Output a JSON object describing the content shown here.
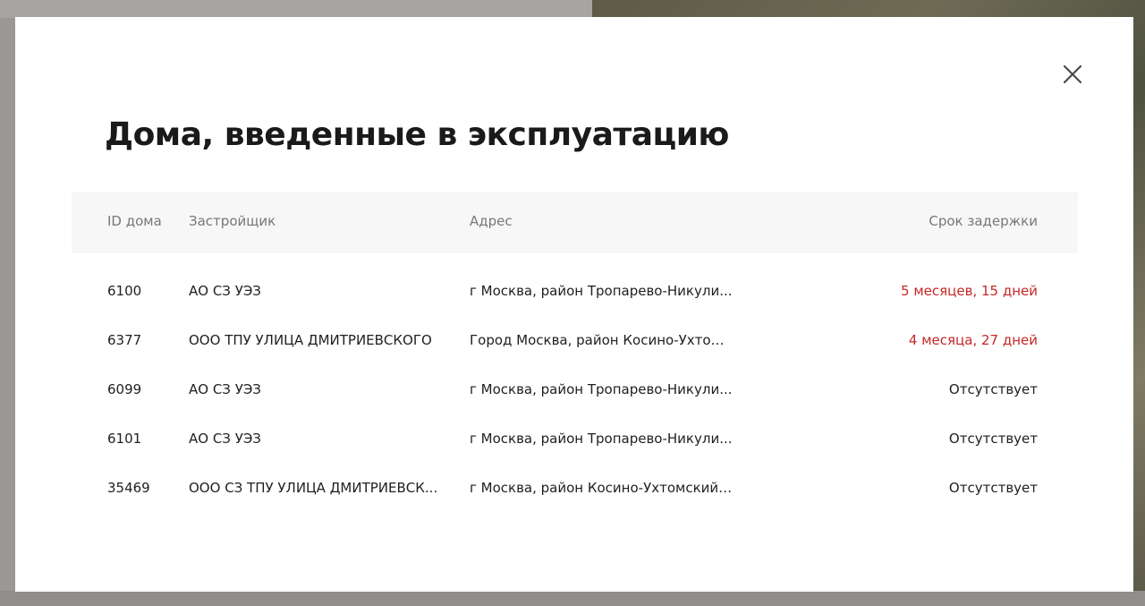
{
  "modal": {
    "title": "Дома, введенные в эксплуатацию"
  },
  "table": {
    "headers": {
      "id": "ID дома",
      "developer": "Застройщик",
      "address": "Адрес",
      "delay": "Срок задержки"
    },
    "rows": [
      {
        "id": "6100",
        "developer": "АО СЗ УЭЗ",
        "address": "г Москва, район Тропарево-Никули...",
        "delay": "5 месяцев, 15 дней",
        "late": true
      },
      {
        "id": "6377",
        "developer": "ООО ТПУ УЛИЦА ДМИТРИЕВСКОГО",
        "address": "Город Москва, район Косино-Ухтом...",
        "delay": "4 месяца, 27 дней",
        "late": true
      },
      {
        "id": "6099",
        "developer": "АО СЗ УЭЗ",
        "address": "г Москва, район Тропарево-Никули...",
        "delay": "Отсутствует",
        "late": false
      },
      {
        "id": "6101",
        "developer": "АО СЗ УЭЗ",
        "address": "г Москва, район Тропарево-Никули...",
        "delay": "Отсутствует",
        "late": false
      },
      {
        "id": "35469",
        "developer": "ООО СЗ ТПУ УЛИЦА ДМИТРИЕВСК...",
        "address": "г Москва, район Косино-Ухтомский,...",
        "delay": "Отсутствует",
        "late": false
      }
    ]
  },
  "colors": {
    "late": "#c62828",
    "header_bg": "#f7f7f7",
    "header_text": "#777777",
    "text": "#1f1f1f"
  },
  "icons": {
    "close": "close-icon"
  }
}
